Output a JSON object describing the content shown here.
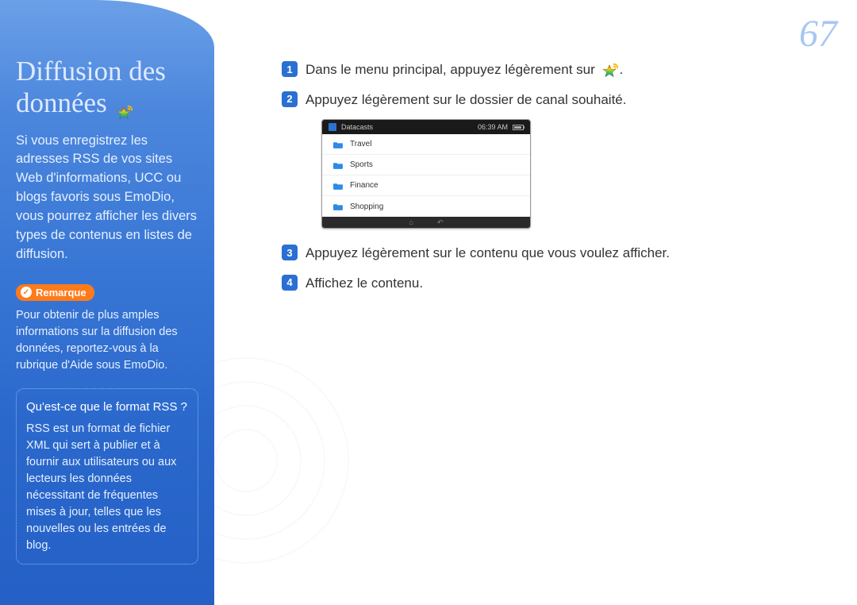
{
  "page_number": "67",
  "sidebar": {
    "title_line1": "Diffusion des",
    "title_line2": "données",
    "intro": "Si vous enregistrez les adresses RSS de vos sites Web d'informations, UCC ou blogs favoris sous EmoDio, vous pourrez afficher les divers types de contenus en listes de diffusion.",
    "remark_label": "Remarque",
    "remark_text": "Pour obtenir de plus amples informations sur la diffusion des données, reportez-vous à la rubrique d'Aide sous EmoDio.",
    "rss_title": "Qu'est-ce que le format RSS ?",
    "rss_text": "RSS est un format de fichier XML qui sert à publier et à fournir aux utilisateurs ou aux lecteurs les données nécessitant de fréquentes mises à jour, telles que les nouvelles ou les entrées de blog."
  },
  "steps": {
    "s1": "Dans le menu principal, appuyez légèrement sur",
    "s1_tail": ".",
    "s2": "Appuyez légèrement sur le dossier de canal souhaité.",
    "s3": "Appuyez légèrement sur le contenu que vous voulez afficher.",
    "s4": "Affichez le contenu."
  },
  "device": {
    "title": "Datacasts",
    "time": "06:39 AM",
    "rows": [
      "Travel",
      "Sports",
      "Finance",
      "Shopping"
    ]
  }
}
